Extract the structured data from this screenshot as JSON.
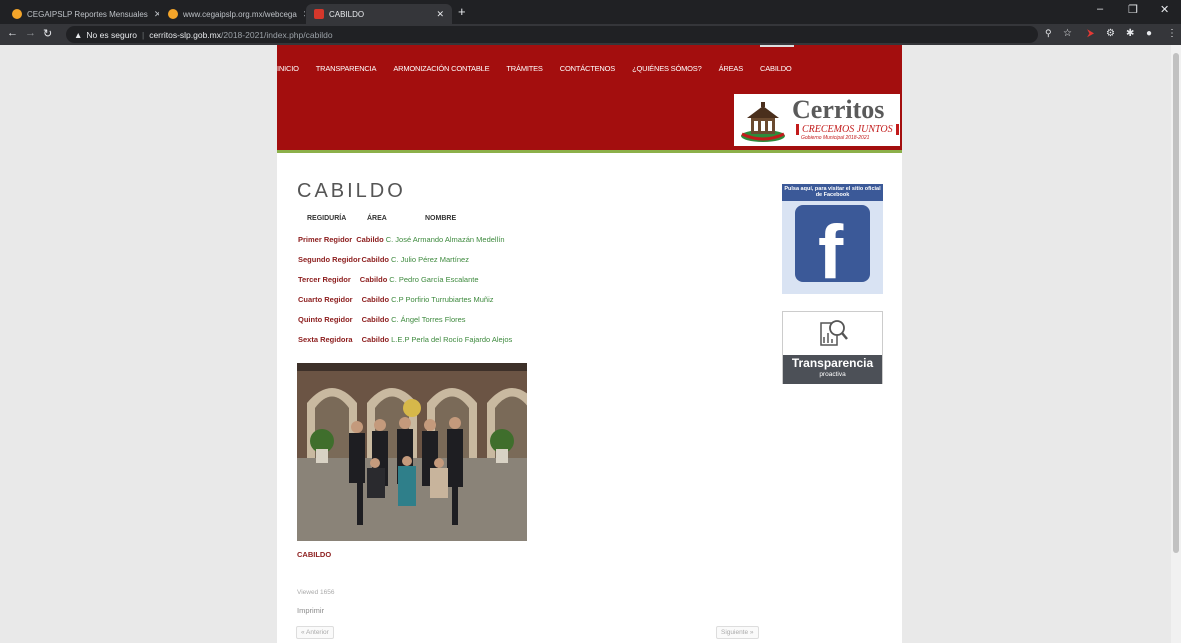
{
  "browser": {
    "tabs": [
      {
        "label": "CEGAIPSLP Reportes Mensuales",
        "favicon_color": "#f4a52a"
      },
      {
        "label": "www.cegaipslp.org.mx/webcega",
        "favicon_color": "#f4a52a"
      },
      {
        "label": "CABILDO",
        "favicon_color": "#d4372b"
      }
    ],
    "security_label": "No es seguro",
    "url_domain": "cerritos-slp.gob.mx",
    "url_path": "/2018-2021/index.php/cabildo"
  },
  "menu": [
    "INICIO",
    "TRANSPARENCIA",
    "ARMONIZACIÓN CONTABLE",
    "TRÁMITES",
    "CONTÁCTENOS",
    "¿QUIÉNES SÓMOS?",
    "ÁREAS",
    "CABILDO"
  ],
  "logo": {
    "name": "Cerritos",
    "slogan": "CRECEMOS JUNTOS",
    "government": "Gobierno Municipal 2018-2021"
  },
  "page_title": "CABILDO",
  "table": {
    "headers": [
      "REGIDURÍA",
      "ÁREA",
      "NOMBRE"
    ],
    "rows": [
      {
        "regiduria": "Primer Regidor",
        "area": "Cabildo",
        "nombre": "C. José Armando Almazán Medellín"
      },
      {
        "regiduria": "Segundo Regidor",
        "area": "Cabildo",
        "nombre": "C. Julio Pérez Martínez"
      },
      {
        "regiduria": "Tercer Regidor",
        "area": "Cabildo",
        "nombre": "C. Pedro García Escalante"
      },
      {
        "regiduria": "Cuarto Regidor",
        "area": "Cabildo",
        "nombre": "C.P Porfirio Turrubiartes Muñiz"
      },
      {
        "regiduria": "Quinto Regidor",
        "area": "Cabildo",
        "nombre": "C. Ángel Torres Flores"
      },
      {
        "regiduria": "Sexta Regidora",
        "area": "Cabildo",
        "nombre": "L.E.P Perla del Rocío Fajardo Alejos"
      }
    ]
  },
  "photo_caption": "CABILDO",
  "hits": "Viewed 1656",
  "print_label": "Imprimir",
  "pager": {
    "prev": "« Anterior",
    "next": "Siguiente »"
  },
  "sidebar": {
    "facebook_text": "Pulsa aquí, para visitar el sitio oficial de Facebook",
    "transparencia_title": "Transparencia",
    "transparencia_subtitle": "proactiva"
  },
  "colors": {
    "header_red": "#a30e0e",
    "accent_green": "#8cb04a",
    "facebook_blue": "#3b5998"
  }
}
